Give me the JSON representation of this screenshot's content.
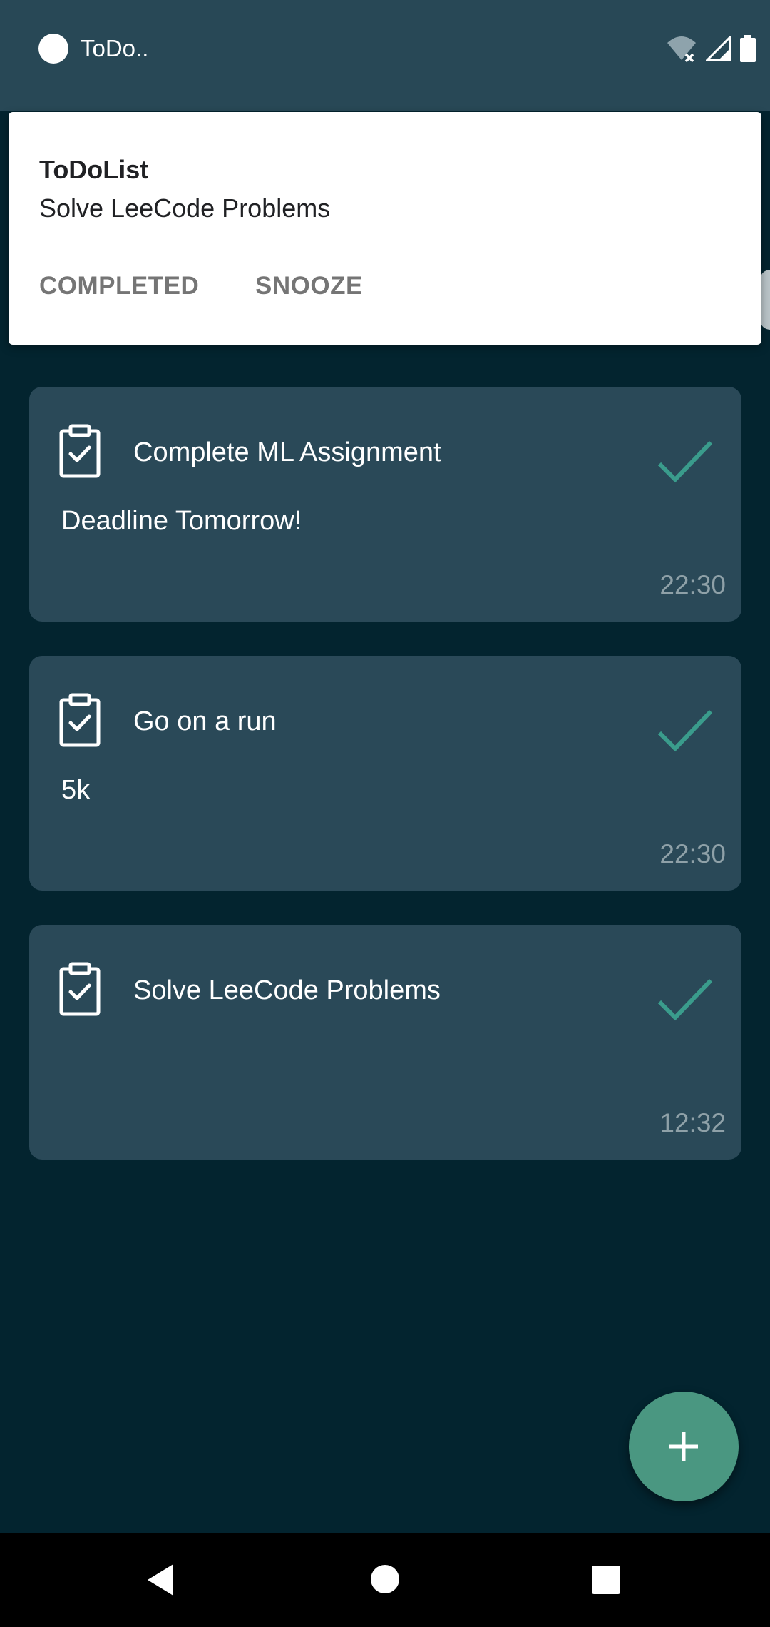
{
  "status_bar": {
    "app_label": "ToDo..",
    "icons": [
      "wifi-off-icon",
      "signal-icon",
      "battery-icon"
    ]
  },
  "notification": {
    "app_name": "ToDoList",
    "text": "Solve LeeCode Problems",
    "actions": [
      "COMPLETED",
      "SNOOZE"
    ]
  },
  "tasks": [
    {
      "title": "Complete ML Assignment",
      "description": "Deadline Tomorrow!",
      "time": "22:30"
    },
    {
      "title": "Go on a run",
      "description": "5k",
      "time": "22:30"
    },
    {
      "title": "Solve LeeCode Problems",
      "description": "",
      "time": "12:32"
    }
  ],
  "fab": {
    "icon": "plus-icon"
  },
  "nav": {
    "icons": [
      "back-icon",
      "home-icon",
      "recents-icon"
    ]
  },
  "colors": {
    "background": "#03242f",
    "card": "#2a4958",
    "accent": "#4a9781",
    "check": "#3a9c8c"
  }
}
